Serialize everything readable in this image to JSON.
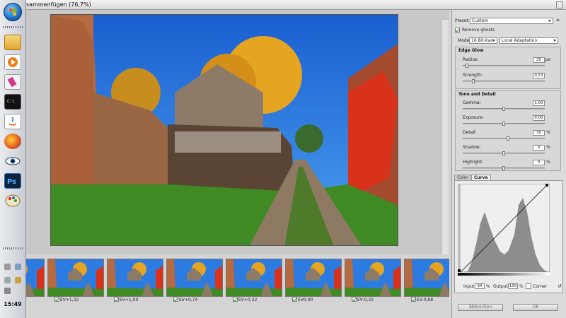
{
  "window": {
    "title": "sammenfügen (76,7%)"
  },
  "taskbar": {
    "clock": "15:49",
    "icons": [
      "windows-start-icon",
      "folder-icon",
      "media-player-icon",
      "paint-icon",
      "terminal-icon",
      "java-icon",
      "firefox-icon",
      "eye-icon",
      "photoshop-icon",
      "palette-icon"
    ]
  },
  "canvas": {
    "zoom_value": "%"
  },
  "filmstrip": [
    {
      "label": ""
    },
    {
      "label": "EV+1,32"
    },
    {
      "label": "EV+1,00"
    },
    {
      "label": "EV+0,74"
    },
    {
      "label": "EV+0,32"
    },
    {
      "label": "EV0,00"
    },
    {
      "label": "EV-0,32"
    },
    {
      "label": "EV-0,68"
    }
  ],
  "panel": {
    "preset_label": "Preset:",
    "preset_value": "Custom",
    "remove_ghosts": "Remove ghosts",
    "mode_label": "Mode:",
    "mode_bits": "16 Bit-Kan",
    "mode_method": "Local Adaptation",
    "edge_glow": {
      "title": "Edge Glow",
      "radius": {
        "label": "Radius:",
        "value": "25",
        "unit": "px",
        "pos": 0.05
      },
      "strength": {
        "label": "Strength:",
        "value": "0,53",
        "unit": "",
        "pos": 0.13
      }
    },
    "tone_detail": {
      "title": "Tone and Detail",
      "gamma": {
        "label": "Gamma:",
        "value": "1,00",
        "unit": "",
        "pos": 0.5
      },
      "exposure": {
        "label": "Exposure:",
        "value": "0,00",
        "unit": "",
        "pos": 0.5
      },
      "detail": {
        "label": "Detail:",
        "value": "30",
        "unit": "%",
        "pos": 0.55
      },
      "shadow": {
        "label": "Shadow:",
        "value": "0",
        "unit": "%",
        "pos": 0.5
      },
      "highlight": {
        "label": "Highlight:",
        "value": "0",
        "unit": "%",
        "pos": 0.5
      }
    },
    "tabs": [
      "Color",
      "Curve"
    ],
    "curve": {
      "input_label": "Input:",
      "input_value": "94",
      "input_unit": "%",
      "output_label": "Output:",
      "output_value": "100",
      "output_unit": "%",
      "corner_label": "Corner"
    },
    "cancel_label": "Abbrechen",
    "ok_label": "OK"
  },
  "colors": {
    "sky": "#1e6fd8",
    "foliage": "#e39a1d",
    "vine": "#d8321a",
    "grass": "#3f8a22"
  }
}
